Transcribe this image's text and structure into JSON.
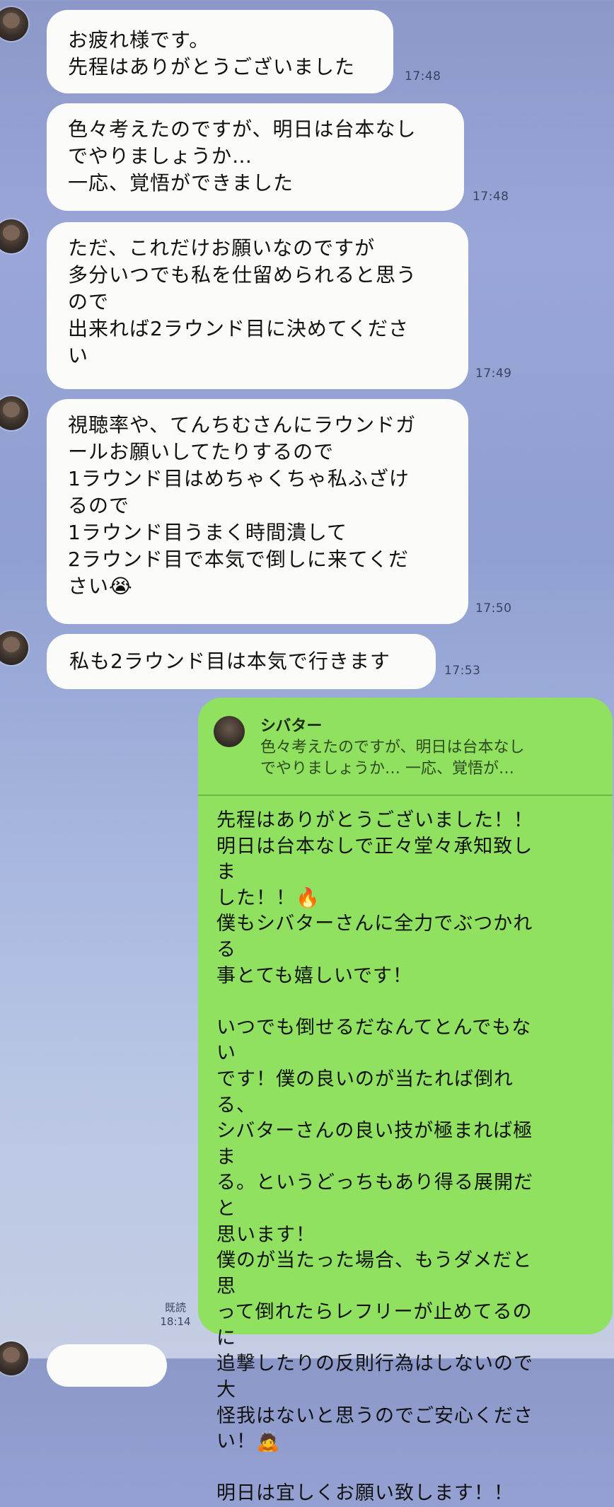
{
  "messages": [
    {
      "text": "お疲れ様です。\n先程はありがとうございました",
      "time": "17:48"
    },
    {
      "text": "色々考えたのですが、明日は台本なし\nでやりましょうか…\n一応、覚悟ができました",
      "time": "17:48"
    },
    {
      "text": "ただ、これだけお願いなのですが\n多分いつでも私を仕留められると思う\nので\n出来れば2ラウンド目に決めてくださ\nい",
      "time": "17:49"
    },
    {
      "text": "視聴率や、てんちむさんにラウンドガ\nールお願いしてたりするので\n1ラウンド目はめちゃくちゃ私ふざけ\nるので\n1ラウンド目うまく時間潰して\n2ラウンド目で本気で倒しに来てくだ\nさい😭",
      "time": "17:50"
    },
    {
      "text": "私も2ラウンド目は本気で行きます",
      "time": "17:53"
    }
  ],
  "reply": {
    "quote_name": "シバター",
    "quote_text": "色々考えたのですが、明日は台本なし\nでやりましょうか… 一応、覚悟が…",
    "body": "先程はありがとうございました！！\n明日は台本なしで正々堂々承知致しま\nした！！🔥\n僕もシバターさんに全力でぶつかれる\n事とても嬉しいです！\n\nいつでも倒せるだなんてとんでもない\nです！僕の良いのが当たれば倒れる、\nシバターさんの良い技が極まれば極ま\nる。というどっちもあり得る展開だと\n思います！\n僕のが当たった場合、もうダメだと思\nって倒れたらレフリーが止めてるのに\n追撃したりの反則行為はしないので大\n怪我はないと思うのでご安心くださ\nい！🙇\n\n明日は宜しくお願い致します！！",
    "read_label": "既読",
    "time": "18:14"
  }
}
